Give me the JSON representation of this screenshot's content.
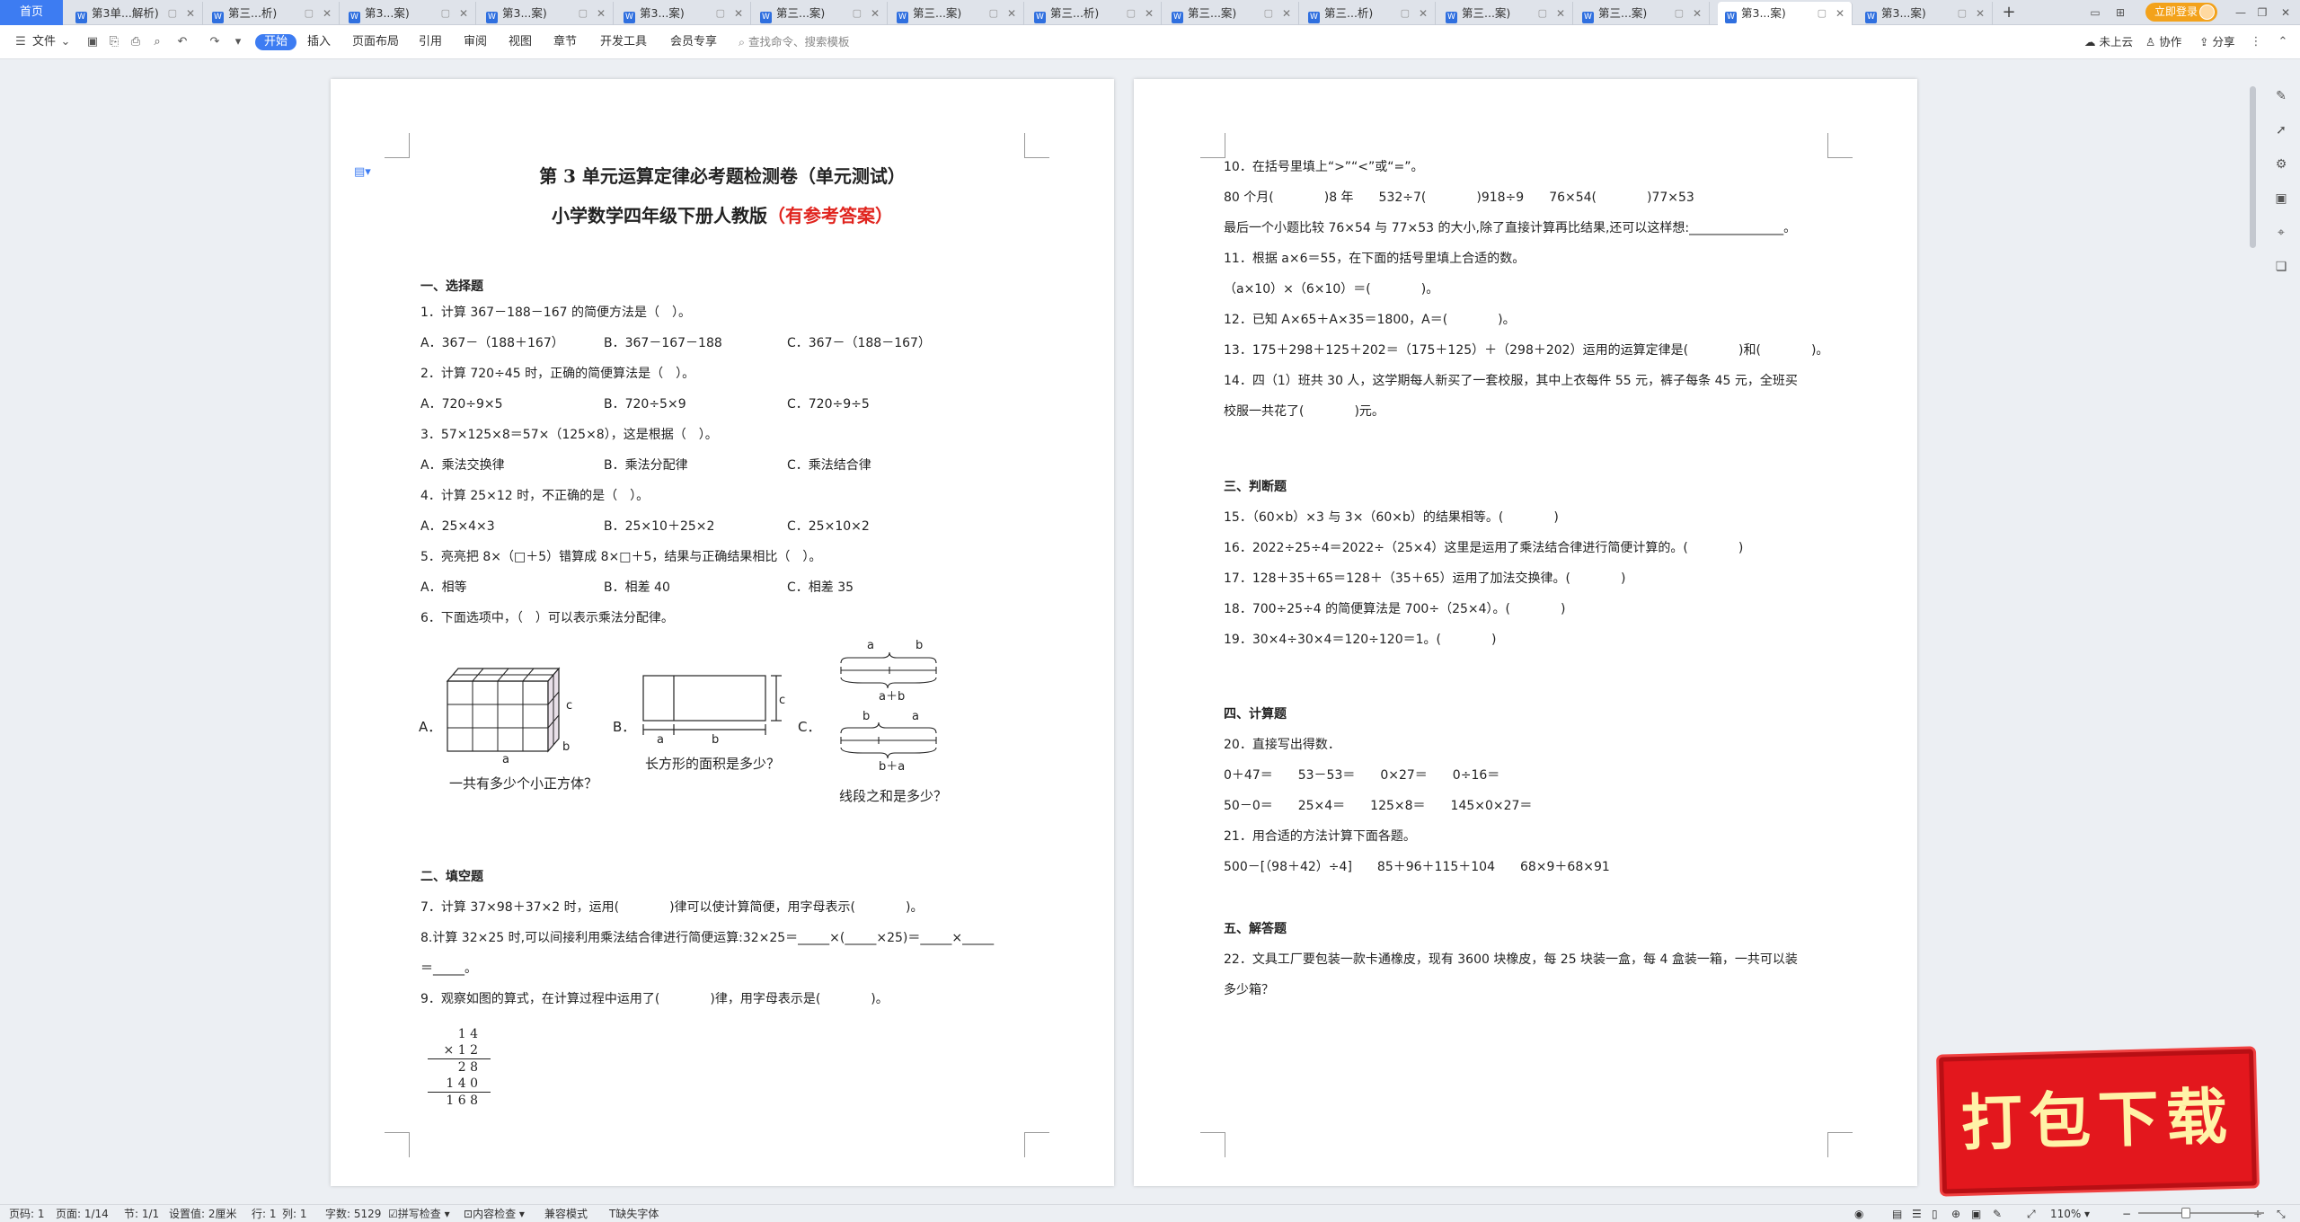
{
  "tabbar": {
    "home": "首页",
    "tabs": [
      {
        "label": "第3单...解析)"
      },
      {
        "label": "第三...析)"
      },
      {
        "label": "第3...案)"
      },
      {
        "label": "第3...案)"
      },
      {
        "label": "第3...案)"
      },
      {
        "label": "第三...案)"
      },
      {
        "label": "第三...案)"
      },
      {
        "label": "第三...析)"
      },
      {
        "label": "第三...案)"
      },
      {
        "label": "第三...析)"
      },
      {
        "label": "第三...案)"
      },
      {
        "label": "第三...案)"
      },
      {
        "label": "第3...案)"
      },
      {
        "label": "第3...案)"
      }
    ],
    "new_tab": "+",
    "login": "立即登录"
  },
  "menubar": {
    "file": "文件",
    "items": [
      "开始",
      "插入",
      "页面布局",
      "引用",
      "审阅",
      "视图",
      "章节",
      "开发工具",
      "会员专享"
    ],
    "search_placeholder": "查找命令、搜索模板",
    "right": [
      "未上云",
      "协作",
      "分享"
    ]
  },
  "page1": {
    "title": "第 3 单元运算定律必考题检测卷（单元测试）",
    "subtitle": "小学数学四年级下册人教版",
    "subtitle_red": "（有参考答案）",
    "sec1": "一、选择题",
    "q1": "1．计算 367－188－167 的简便方法是（　）。",
    "q1a": "A．367－（188＋167）",
    "q1b": "B．367－167－188",
    "q1c": "C．367－（188－167）",
    "q2": "2．计算 720÷45 时，正确的简便算法是（　）。",
    "q2a": "A．720÷9×5",
    "q2b": "B．720÷5×9",
    "q2c": "C．720÷9÷5",
    "q3": "3．57×125×8＝57×（125×8），这是根据（　）。",
    "q3a": "A．乘法交换律",
    "q3b": "B．乘法分配律",
    "q3c": "C．乘法结合律",
    "q4": "4．计算 25×12 时，不正确的是（　）。",
    "q4a": "A．25×4×3",
    "q4b": "B．25×10＋25×2",
    "q4c": "C．25×10×2",
    "q5": "5．亮亮把 8×（□＋5）错算成 8×□＋5，结果与正确结果相比（　）。",
    "q5a": "A．相等",
    "q5b": "B．相差 40",
    "q5c": "C．相差 35",
    "q6": "6．下面选项中，（　）可以表示乘法分配律。",
    "fig_a_letter": "A．",
    "fig_b_letter": "B．",
    "fig_c_letter": "C．",
    "fig_a_caption": "一共有多少个小正方体？",
    "fig_b_caption": "长方形的面积是多少？",
    "fig_c_caption": "线段之和是多少？",
    "fig_a_a": "a",
    "fig_a_b": "b",
    "fig_a_c": "c",
    "fig_b_a": "a",
    "fig_b_b": "b",
    "fig_b_c": "c",
    "fig_c_top_a": "a",
    "fig_c_top_b": "b",
    "fig_c_sum1": "a＋b",
    "fig_c_bot_b": "b",
    "fig_c_bot_a": "a",
    "fig_c_sum2": "b＋a",
    "sec2": "二、填空题",
    "q7": "7．计算 37×98＋37×2 时，运用(　　　　)律可以使计算简便，用字母表示(　　　　)。",
    "q8": "8.计算 32×25 时,可以间接利用乘法结合律进行简便运算:32×25＝_____×(_____×25)＝_____×_____",
    "q8b": "＝_____。",
    "q9": "9．观察如图的算式，在计算过程中运用了(　　　　)律，用字母表示是(　　　　)。",
    "calc_r1": "1 4",
    "calc_r2": "×  1 2",
    "calc_r3": "2 8",
    "calc_r4": "1 4 0",
    "calc_r5": "1 6 8"
  },
  "page2": {
    "q10": "10．在括号里填上“>”“<”或“=”。",
    "q10a": "80 个月(　　　　)8 年　　532÷7(　　　　)918÷9　　76×54(　　　　)77×53",
    "q10b": "最后一个小题比较 76×54 与 77×53 的大小,除了直接计算再比结果,还可以这样想:_______________。",
    "q11": "11．根据 a×6＝55，在下面的括号里填上合适的数。",
    "q11a": "（a×10）×（6×10）＝(　　　　)。",
    "q12": "12．已知 A×65＋A×35＝1800，A＝(　　　　)。",
    "q13": "13．175＋298＋125＋202＝（175＋125）＋（298＋202）运用的运算定律是(　　　　)和(　　　　)。",
    "q14": "14．四（1）班共 30 人，这学期每人新买了一套校服，其中上衣每件 55 元，裤子每条 45 元，全班买",
    "q14b": "校服一共花了(　　　　)元。",
    "sec3": "三、判断题",
    "q15": "15．（60×b）×3 与 3×（60×b）的结果相等。(　　　　)",
    "q16": "16．2022÷25÷4＝2022÷（25×4）这里是运用了乘法结合律进行简便计算的。(　　　　)",
    "q17": "17．128＋35＋65＝128＋（35＋65）运用了加法交换律。(　　　　)",
    "q18": "18．700÷25÷4 的简便算法是 700÷（25×4）。(　　　　)",
    "q19": "19．30×4÷30×4＝120÷120＝1。(　　　　)",
    "sec4": "四、计算题",
    "q20": "20．直接写出得数．",
    "q20a": "0＋47＝　　53－53＝　　0×27＝　　0÷16＝",
    "q20b": "50－0＝　　25×4＝　　125×8＝　　145×0×27＝",
    "q21": "21．用合适的方法计算下面各题。",
    "q21a": "500－[（98＋42）÷4]　　85＋96＋115＋104　　68×9＋68×91",
    "sec5": "五、解答题",
    "q22": "22．文具工厂要包装一款卡通橡皮，现有 3600 块橡皮，每 25 块装一盒，每 4 盒装一箱，一共可以装",
    "q22b": "多少箱？"
  },
  "statusbar": {
    "page_num": "页码: 1",
    "pages": "页面: 1/14",
    "section": "节: 1/1",
    "setting": "设置值: 2厘米",
    "row": "行: 1",
    "col": "列: 1",
    "words": "字数: 5129",
    "spell": "拼写检查",
    "content": "内容检查",
    "compat": "兼容模式",
    "missing_font": "缺失字体",
    "zoom": "110%"
  },
  "stamp": {
    "text": "打包下载"
  },
  "colors": {
    "accent": "#3d7cf2",
    "answer_red": "#e0241e",
    "stamp_red": "#e3171d"
  }
}
